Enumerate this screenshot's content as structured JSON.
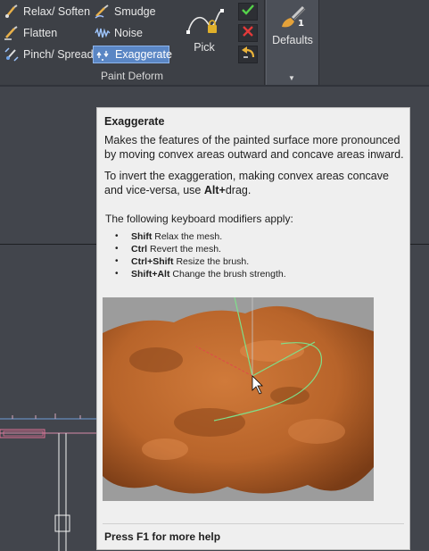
{
  "ribbon": {
    "group_label": "Paint Deform",
    "tools": [
      {
        "label": "Relax/ Soften",
        "icon": "relax-soften-icon"
      },
      {
        "label": "Smudge",
        "icon": "smudge-icon"
      },
      {
        "label": "Flatten",
        "icon": "flatten-icon"
      },
      {
        "label": "Noise",
        "icon": "noise-icon"
      },
      {
        "label": "Pinch/ Spread",
        "icon": "pinch-spread-icon"
      },
      {
        "label": "Exaggerate",
        "icon": "exaggerate-icon",
        "active": true
      }
    ],
    "pick_label": "Pick",
    "defaults_label": "Defaults"
  },
  "tooltip": {
    "title": "Exaggerate",
    "description": "Makes the features of the painted surface more pronounced by moving convex areas outward and concave areas inward.",
    "invert_prefix": "To invert the exaggeration, making convex areas concave and vice-versa, use ",
    "invert_key": "Alt+",
    "invert_suffix": "drag.",
    "modifiers_intro": "The following keyboard modifiers apply:",
    "modifiers": [
      {
        "key": "Shift",
        "text": "Relax the mesh."
      },
      {
        "key": "Ctrl",
        "text": "Revert the mesh."
      },
      {
        "key": "Ctrl+Shift",
        "text": "Resize the brush."
      },
      {
        "key": "Shift+Alt",
        "text": "Change the brush strength."
      }
    ],
    "footer": "Press F1 for more help"
  },
  "colors": {
    "accent": "#5a86c4",
    "ribbon_bg": "#3d4046",
    "viewport_bg": "#42454c",
    "tooltip_bg": "#efefef",
    "terrain": "#b8642a",
    "gizmo": "#7fe08a"
  }
}
